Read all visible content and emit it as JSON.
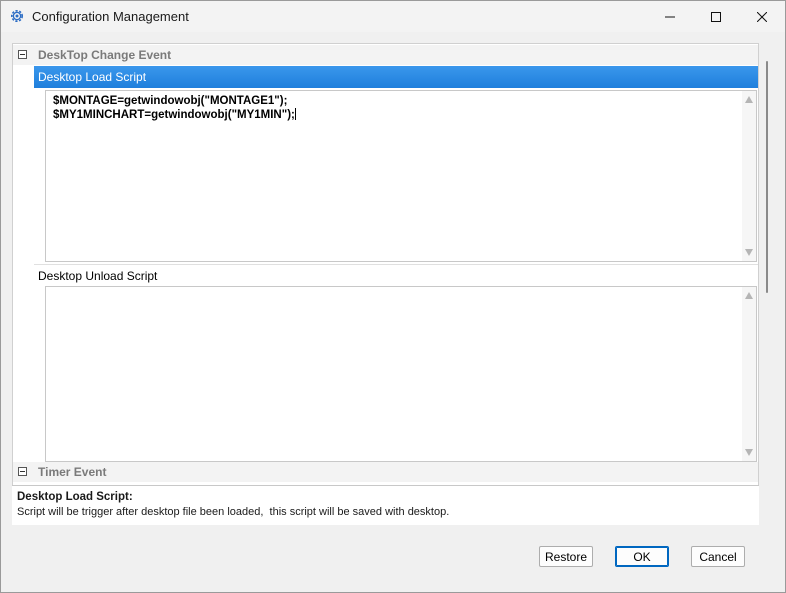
{
  "window": {
    "title": "Configuration Management",
    "controls": {
      "minimize": "minimize-icon",
      "maximize": "maximize-icon",
      "close": "close-icon"
    }
  },
  "groups": {
    "desktop_change": {
      "label": "DeskTop Change Event",
      "icon": "collapse-icon"
    },
    "timer": {
      "label": "Timer Event",
      "icon": "collapse-icon"
    }
  },
  "properties": {
    "load_script": {
      "label": "Desktop Load Script",
      "lines": [
        "$MONTAGE=getwindowobj(\"MONTAGE1\");",
        "$MY1MINCHART=getwindowobj(\"MY1MIN\");"
      ]
    },
    "unload_script": {
      "label": "Desktop Unload Script",
      "lines": []
    }
  },
  "description": {
    "title": "Desktop Load Script:",
    "text": "Script will be trigger after desktop file been loaded,  this script will be saved with desktop."
  },
  "buttons": {
    "restore": "Restore",
    "ok": "OK",
    "cancel": "Cancel"
  },
  "colors": {
    "selection": "#1f7fdc",
    "accent": "#0067c0"
  }
}
